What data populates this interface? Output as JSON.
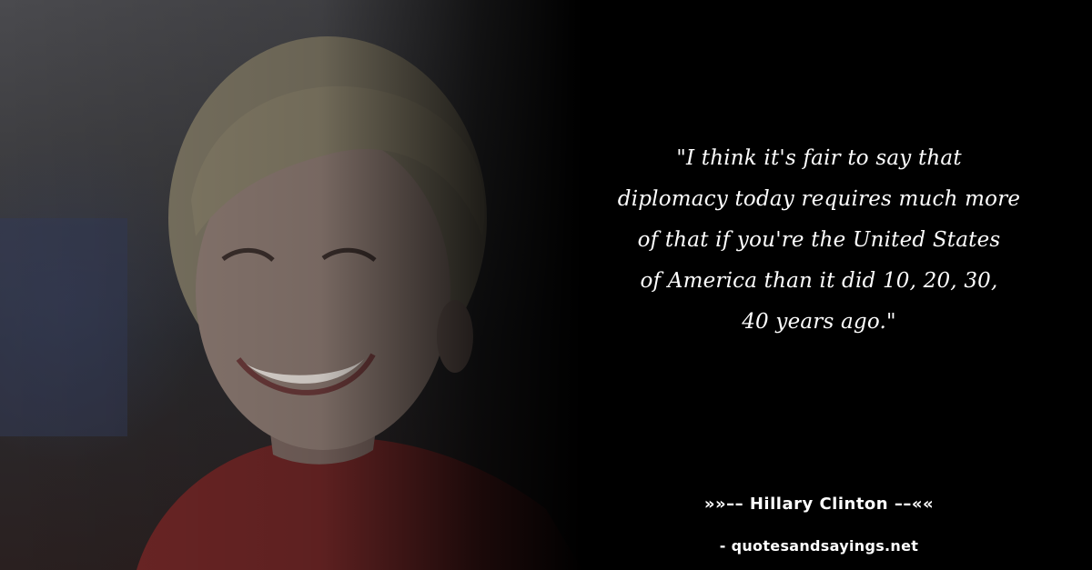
{
  "quote": {
    "lines": [
      "\"I think it's fair to say that",
      "diplomacy today requires much more",
      "of that if you're the United States",
      "of America than it did 10, 20, 30,",
      "40 years ago.\""
    ]
  },
  "author": {
    "text": "»»–– Hillary Clinton ––««"
  },
  "site": {
    "text": "- quotesandsayings.net"
  },
  "colors": {
    "background": "#000000",
    "text": "#ffffff",
    "jacket": "#8a2a2a"
  }
}
